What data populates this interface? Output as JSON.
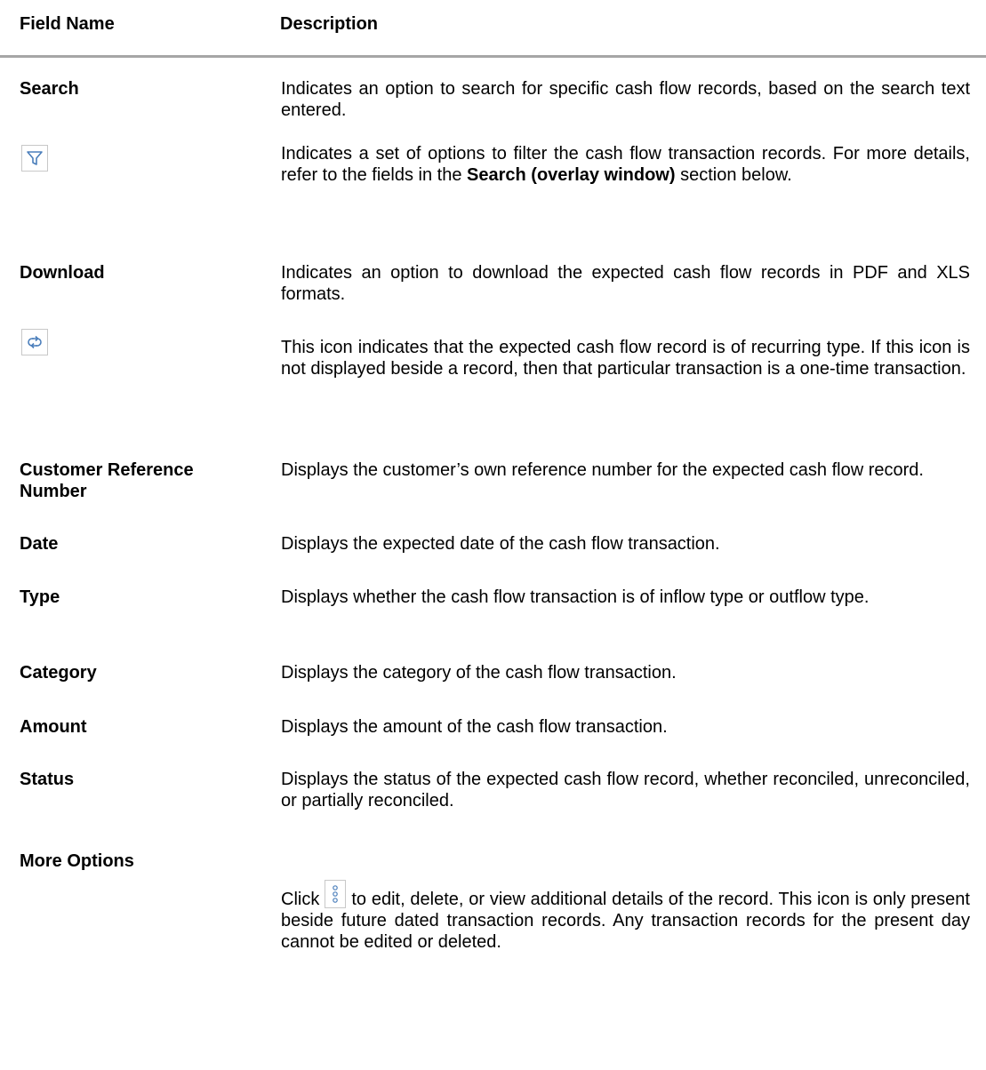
{
  "header": {
    "field_name": "Field Name",
    "description": "Description"
  },
  "rows": [
    {
      "field": "Search",
      "description": "Indicates an option to search for specific cash flow records, based on the search text entered."
    },
    {
      "field_icon": "filter-icon",
      "description_1": "Indicates a set of options to filter the cash flow transaction records. For more details, refer to the fields in the ",
      "description_bold": "Search (overlay window)",
      "description_2": " section below."
    },
    {
      "field": "Download",
      "description": "Indicates an option to download the expected cash flow records in PDF and XLS formats."
    },
    {
      "field_icon": "recurring-icon",
      "description": "This icon indicates that the expected cash flow record is of recurring type. If this icon is not displayed beside a record, then that particular transaction is a one-time transaction."
    },
    {
      "field": "Customer Reference Number",
      "description": "Displays the customer’s own reference number for the expected cash flow record."
    },
    {
      "field": "Date",
      "description": "Displays the expected date of the cash flow transaction."
    },
    {
      "field": "Type",
      "description": "Displays whether the cash flow transaction is of inflow type or outflow type."
    },
    {
      "field": "Category",
      "description": "Displays the category of the cash flow transaction."
    },
    {
      "field": "Amount",
      "description": "Displays the amount of the cash flow transaction."
    },
    {
      "field": "Status",
      "description": "Displays the status of the expected cash flow record, whether reconciled, unreconciled, or partially reconciled."
    },
    {
      "field": "More Options",
      "description_1": "Click",
      "description_icon": "kebab-menu-icon",
      "description_2": "to edit, delete, or view additional details of the record. This icon is only present beside future dated transaction records. Any transaction records for the present day cannot be edited or deleted."
    }
  ],
  "colors": {
    "text": "#000000",
    "rule": "#a6a6a6",
    "icon_border": "#c8c8c8",
    "icon_blue": "#4a7ebb"
  }
}
